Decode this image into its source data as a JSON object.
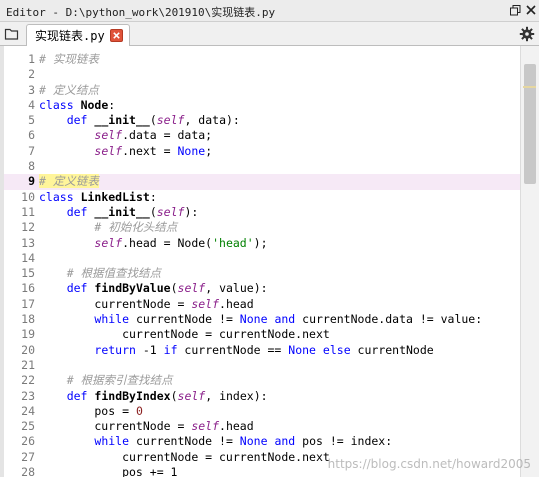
{
  "window": {
    "title": "Editor - D:\\python_work\\201910\\实现链表.py"
  },
  "tab": {
    "label": "实现链表.py"
  },
  "icons": [
    "undock-icon",
    "close-icon",
    "browse-tabs-icon",
    "tab-close-icon",
    "gear-icon"
  ],
  "colors": {
    "keyword": "#0000ff",
    "comment": "#9a9a9a",
    "self": "#8a1f8a",
    "string": "#008000",
    "highlight_line": "#f6e9f6",
    "tab_close": "#e0533a"
  },
  "editor": {
    "current_line": 9,
    "lines": [
      {
        "n": "1",
        "tokens": [
          {
            "t": "# 实现链表",
            "c": "cm"
          }
        ]
      },
      {
        "n": "2",
        "tokens": []
      },
      {
        "n": "3",
        "tokens": [
          {
            "t": "# 定义结点",
            "c": "cm"
          }
        ]
      },
      {
        "n": "4",
        "tokens": [
          {
            "t": "class",
            "c": "kw"
          },
          {
            "t": " ",
            "c": ""
          },
          {
            "t": "Node",
            "c": "cls"
          },
          {
            "t": ":",
            "c": ""
          }
        ]
      },
      {
        "n": "5",
        "tokens": [
          {
            "t": "    ",
            "c": ""
          },
          {
            "t": "def",
            "c": "kw"
          },
          {
            "t": " ",
            "c": ""
          },
          {
            "t": "__init__",
            "c": "fn"
          },
          {
            "t": "(",
            "c": ""
          },
          {
            "t": "self",
            "c": "self"
          },
          {
            "t": ", data):",
            "c": ""
          }
        ]
      },
      {
        "n": "6",
        "tokens": [
          {
            "t": "        ",
            "c": ""
          },
          {
            "t": "self",
            "c": "self"
          },
          {
            "t": ".data = data;",
            "c": ""
          }
        ]
      },
      {
        "n": "7",
        "tokens": [
          {
            "t": "        ",
            "c": ""
          },
          {
            "t": "self",
            "c": "self"
          },
          {
            "t": ".next = ",
            "c": ""
          },
          {
            "t": "None",
            "c": "kw"
          },
          {
            "t": ";",
            "c": ""
          }
        ]
      },
      {
        "n": "8",
        "tokens": []
      },
      {
        "n": "9",
        "tokens": [
          {
            "t": "# 定义链表",
            "c": "cm yel"
          }
        ]
      },
      {
        "n": "10",
        "tokens": [
          {
            "t": "class",
            "c": "kw"
          },
          {
            "t": " ",
            "c": ""
          },
          {
            "t": "LinkedList",
            "c": "cls"
          },
          {
            "t": ":",
            "c": ""
          }
        ]
      },
      {
        "n": "11",
        "tokens": [
          {
            "t": "    ",
            "c": ""
          },
          {
            "t": "def",
            "c": "kw"
          },
          {
            "t": " ",
            "c": ""
          },
          {
            "t": "__init__",
            "c": "fn"
          },
          {
            "t": "(",
            "c": ""
          },
          {
            "t": "self",
            "c": "self"
          },
          {
            "t": "):",
            "c": ""
          }
        ]
      },
      {
        "n": "12",
        "tokens": [
          {
            "t": "        ",
            "c": ""
          },
          {
            "t": "# 初始化头结点",
            "c": "cm"
          }
        ]
      },
      {
        "n": "13",
        "tokens": [
          {
            "t": "        ",
            "c": ""
          },
          {
            "t": "self",
            "c": "self"
          },
          {
            "t": ".head = Node(",
            "c": ""
          },
          {
            "t": "'head'",
            "c": "str"
          },
          {
            "t": ");",
            "c": ""
          }
        ]
      },
      {
        "n": "14",
        "tokens": []
      },
      {
        "n": "15",
        "tokens": [
          {
            "t": "    ",
            "c": ""
          },
          {
            "t": "# 根据值查找结点",
            "c": "cm"
          }
        ]
      },
      {
        "n": "16",
        "tokens": [
          {
            "t": "    ",
            "c": ""
          },
          {
            "t": "def",
            "c": "kw"
          },
          {
            "t": " ",
            "c": ""
          },
          {
            "t": "findByValue",
            "c": "fn"
          },
          {
            "t": "(",
            "c": ""
          },
          {
            "t": "self",
            "c": "self"
          },
          {
            "t": ", value):",
            "c": ""
          }
        ]
      },
      {
        "n": "17",
        "tokens": [
          {
            "t": "        currentNode = ",
            "c": ""
          },
          {
            "t": "self",
            "c": "self"
          },
          {
            "t": ".head",
            "c": ""
          }
        ]
      },
      {
        "n": "18",
        "tokens": [
          {
            "t": "        ",
            "c": ""
          },
          {
            "t": "while",
            "c": "kw"
          },
          {
            "t": " currentNode != ",
            "c": ""
          },
          {
            "t": "None",
            "c": "kw"
          },
          {
            "t": " ",
            "c": ""
          },
          {
            "t": "and",
            "c": "kw"
          },
          {
            "t": " currentNode.data != value:",
            "c": ""
          }
        ]
      },
      {
        "n": "19",
        "tokens": [
          {
            "t": "            currentNode = currentNode.next",
            "c": ""
          }
        ]
      },
      {
        "n": "20",
        "tokens": [
          {
            "t": "        ",
            "c": ""
          },
          {
            "t": "return",
            "c": "kw"
          },
          {
            "t": " -1 ",
            "c": ""
          },
          {
            "t": "if",
            "c": "kw"
          },
          {
            "t": " currentNode == ",
            "c": ""
          },
          {
            "t": "None",
            "c": "kw"
          },
          {
            "t": " ",
            "c": ""
          },
          {
            "t": "else",
            "c": "kw"
          },
          {
            "t": " currentNode",
            "c": ""
          }
        ]
      },
      {
        "n": "21",
        "tokens": []
      },
      {
        "n": "22",
        "tokens": [
          {
            "t": "    ",
            "c": ""
          },
          {
            "t": "# 根据索引查找结点",
            "c": "cm"
          }
        ]
      },
      {
        "n": "23",
        "tokens": [
          {
            "t": "    ",
            "c": ""
          },
          {
            "t": "def",
            "c": "kw"
          },
          {
            "t": " ",
            "c": ""
          },
          {
            "t": "findByIndex",
            "c": "fn"
          },
          {
            "t": "(",
            "c": ""
          },
          {
            "t": "self",
            "c": "self"
          },
          {
            "t": ", index):",
            "c": ""
          }
        ]
      },
      {
        "n": "24",
        "tokens": [
          {
            "t": "        pos = ",
            "c": ""
          },
          {
            "t": "0",
            "c": "num"
          }
        ]
      },
      {
        "n": "25",
        "tokens": [
          {
            "t": "        currentNode = ",
            "c": ""
          },
          {
            "t": "self",
            "c": "self"
          },
          {
            "t": ".head",
            "c": ""
          }
        ]
      },
      {
        "n": "26",
        "tokens": [
          {
            "t": "        ",
            "c": ""
          },
          {
            "t": "while",
            "c": "kw"
          },
          {
            "t": " currentNode != ",
            "c": ""
          },
          {
            "t": "None",
            "c": "kw"
          },
          {
            "t": " ",
            "c": ""
          },
          {
            "t": "and",
            "c": "kw"
          },
          {
            "t": " pos != index:",
            "c": ""
          }
        ]
      },
      {
        "n": "27",
        "tokens": [
          {
            "t": "            currentNode = currentNode.next",
            "c": ""
          }
        ]
      },
      {
        "n": "28",
        "tokens": [
          {
            "t": "            pos += 1",
            "c": ""
          }
        ]
      }
    ]
  },
  "watermark": "https://blog.csdn.net/howard2005"
}
